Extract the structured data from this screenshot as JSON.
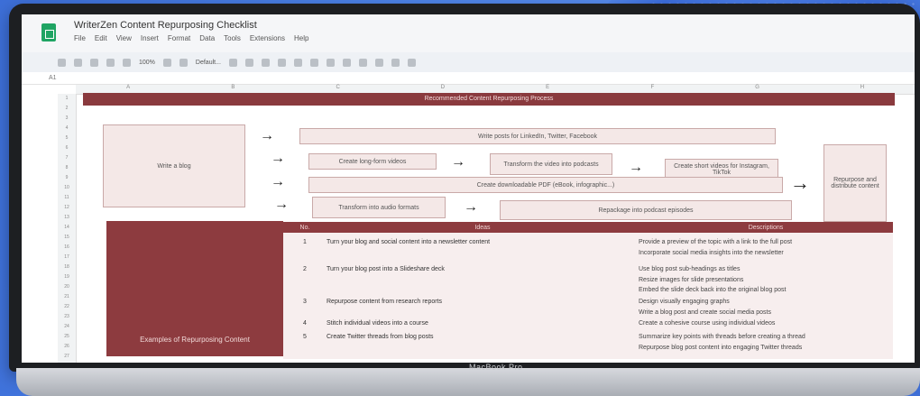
{
  "app": {
    "doc_title": "WriterZen Content Repurposing Checklist",
    "menu": [
      "File",
      "Edit",
      "View",
      "Insert",
      "Format",
      "Data",
      "Tools",
      "Extensions",
      "Help"
    ],
    "toolbar": {
      "zoom": "100%",
      "font": "Default..."
    },
    "cell_ref": "A1"
  },
  "columns": [
    "A",
    "B",
    "C",
    "D",
    "E",
    "F",
    "G",
    "H"
  ],
  "rows": [
    "1",
    "2",
    "3",
    "4",
    "5",
    "6",
    "7",
    "8",
    "9",
    "10",
    "11",
    "12",
    "13",
    "14",
    "15",
    "16",
    "17",
    "18",
    "19",
    "20",
    "21",
    "22",
    "23",
    "24",
    "25",
    "26",
    "27"
  ],
  "sheet": {
    "banner": "Recommended Content Repurposing Process",
    "source": "Write a blog",
    "flow": {
      "step1": "Write posts for LinkedIn, Twitter, Facebook",
      "step2a": "Create long-form videos",
      "step2b": "Transform the video into podcasts",
      "step2c": "Create short videos for Instagram, TikTok",
      "step3": "Create downloadable PDF (eBook, infographic...)",
      "step4a": "Transform into audio formats",
      "step4b": "Repackage into podcast episodes"
    },
    "right_box": "Repurpose and distribute content",
    "side_label": "Examples of Repurposing Content",
    "table": {
      "headers": [
        "No.",
        "Ideas",
        "Descriptions"
      ],
      "rows": [
        {
          "no": "1",
          "idea": "Turn your blog and social content into a newsletter content",
          "desc": "Provide a preview of the topic with a link to the full post"
        },
        {
          "no": "",
          "idea": "",
          "desc": "Incorporate social media insights into the newsletter"
        },
        {
          "no": "2",
          "idea": "Turn your blog post into a Slideshare deck",
          "desc": "Use blog post sub-headings as titles"
        },
        {
          "no": "",
          "idea": "",
          "desc": "Resize images for slide presentations"
        },
        {
          "no": "",
          "idea": "",
          "desc": "Embed the slide deck back into the original blog post"
        },
        {
          "no": "3",
          "idea": "Repurpose content from research reports",
          "desc": "Design visually engaging graphs"
        },
        {
          "no": "",
          "idea": "",
          "desc": "Write a blog post and create social media posts"
        },
        {
          "no": "4",
          "idea": "Stitch individual videos into a course",
          "desc": "Create a cohesive course using individual videos"
        },
        {
          "no": "5",
          "idea": "Create Twitter threads from blog posts",
          "desc": "Summarize key points with threads before creating a thread"
        },
        {
          "no": "",
          "idea": "",
          "desc": "Repurpose blog post content into engaging Twitter threads"
        }
      ]
    }
  },
  "laptop_brand": "MacBook Pro"
}
